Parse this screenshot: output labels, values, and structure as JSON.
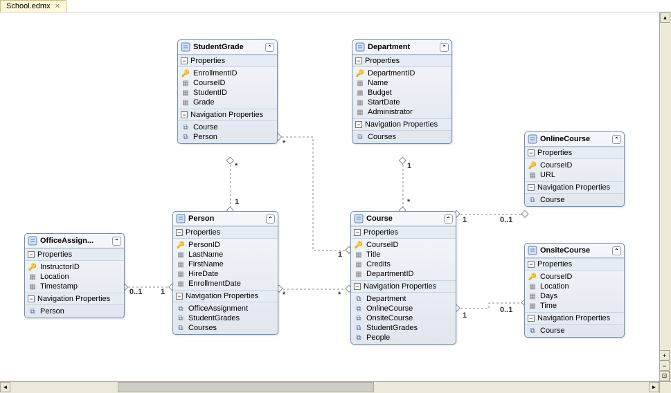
{
  "tab": {
    "label": "School.edmx"
  },
  "entities": {
    "officeAssignment": {
      "title": "OfficeAssign...",
      "props_label": "Properties",
      "nav_label": "Navigation Properties",
      "props": [
        "InstructorID",
        "Location",
        "Timestamp"
      ],
      "navs": [
        "Person"
      ]
    },
    "studentGrade": {
      "title": "StudentGrade",
      "props_label": "Properties",
      "nav_label": "Navigation Properties",
      "props": [
        "EnrollmentID",
        "CourseID",
        "StudentID",
        "Grade"
      ],
      "navs": [
        "Course",
        "Person"
      ]
    },
    "person": {
      "title": "Person",
      "props_label": "Properties",
      "nav_label": "Navigation Properties",
      "props": [
        "PersonID",
        "LastName",
        "FirstName",
        "HireDate",
        "EnrollmentDate"
      ],
      "navs": [
        "OfficeAssignment",
        "StudentGrades",
        "Courses"
      ]
    },
    "department": {
      "title": "Department",
      "props_label": "Properties",
      "nav_label": "Navigation Properties",
      "props": [
        "DepartmentID",
        "Name",
        "Budget",
        "StartDate",
        "Administrator"
      ],
      "navs": [
        "Courses"
      ]
    },
    "course": {
      "title": "Course",
      "props_label": "Properties",
      "nav_label": "Navigation Properties",
      "props": [
        "CourseID",
        "Title",
        "Credits",
        "DepartmentID"
      ],
      "navs": [
        "Department",
        "OnlineCourse",
        "OnsiteCourse",
        "StudentGrades",
        "People"
      ]
    },
    "onlineCourse": {
      "title": "OnlineCourse",
      "props_label": "Properties",
      "nav_label": "Navigation Properties",
      "props": [
        "CourseID",
        "URL"
      ],
      "navs": [
        "Course"
      ]
    },
    "onsiteCourse": {
      "title": "OnsiteCourse",
      "props_label": "Properties",
      "nav_label": "Navigation Properties",
      "props": [
        "CourseID",
        "Location",
        "Days",
        "Time"
      ],
      "navs": [
        "Course"
      ]
    }
  },
  "cardinalities": {
    "oa_person_0_1": "0..1",
    "oa_person_1": "1",
    "sg_person_star": "*",
    "sg_person_1": "1",
    "sg_course_star": "*",
    "sg_course_1": "1",
    "dept_course_1": "1",
    "dept_course_star": "*",
    "course_online_1": "1",
    "course_online_0_1": "0..1",
    "course_onsite_1": "1",
    "course_onsite_0_1": "0..1",
    "person_course_star_l": "*",
    "person_course_star_r": "*"
  }
}
